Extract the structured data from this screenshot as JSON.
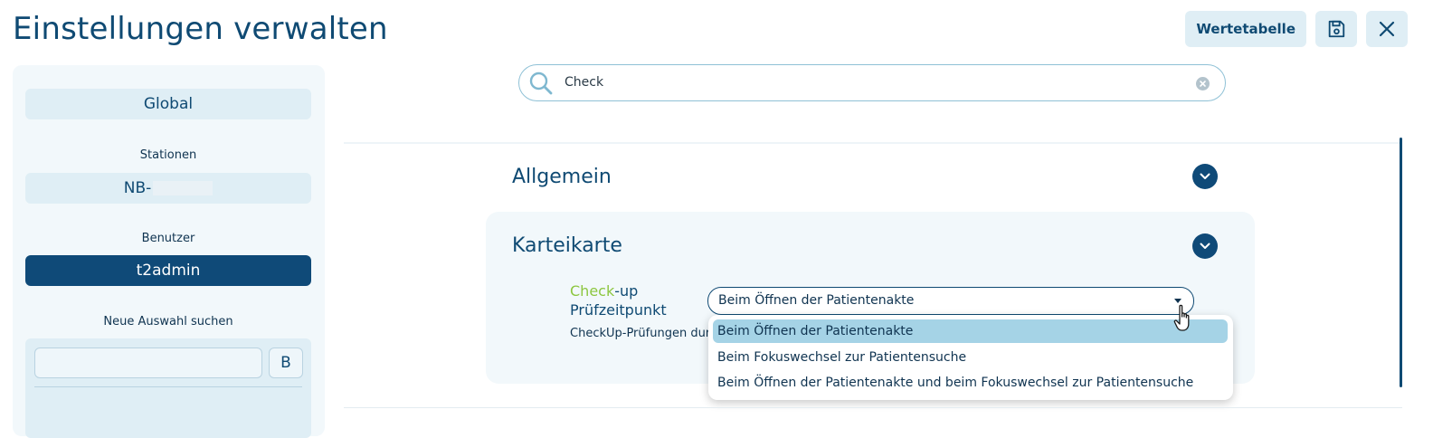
{
  "header": {
    "title": "Einstellungen verwalten",
    "wertetabelle_label": "Wertetabelle",
    "save_icon": "save-icon",
    "close_icon": "close-icon"
  },
  "sidebar": {
    "global_label": "Global",
    "stationen_heading": "Stationen",
    "station_value": "NB-",
    "benutzer_heading": "Benutzer",
    "benutzer_value": "t2admin",
    "neue_auswahl_heading": "Neue Auswahl suchen",
    "search_value": "",
    "b_button_label": "B"
  },
  "search": {
    "value": "Check",
    "icon": "search-icon",
    "clear_icon": "clear-icon"
  },
  "sections": {
    "allgemein": "Allgemein",
    "karteikarte": "Karteikarte"
  },
  "setting": {
    "label_highlight": "Check",
    "label_rest": "-up",
    "label_line2": "Prüfzeitpunkt",
    "description": "CheckUp-Prüfungen durc",
    "selected_value": "Beim Öffnen der Patientenakte"
  },
  "dropdown": {
    "options": [
      "Beim Öffnen der Patientenakte",
      "Beim Fokuswechsel zur Patientensuche",
      "Beim Öffnen der Patientenakte und beim Fokuswechsel zur Patientensuche"
    ],
    "selected_index": 0
  },
  "colors": {
    "primary": "#0f4a78",
    "light": "#dfeef5",
    "highlight_green": "#8cc63f",
    "selected_option": "#a5d3e6"
  }
}
